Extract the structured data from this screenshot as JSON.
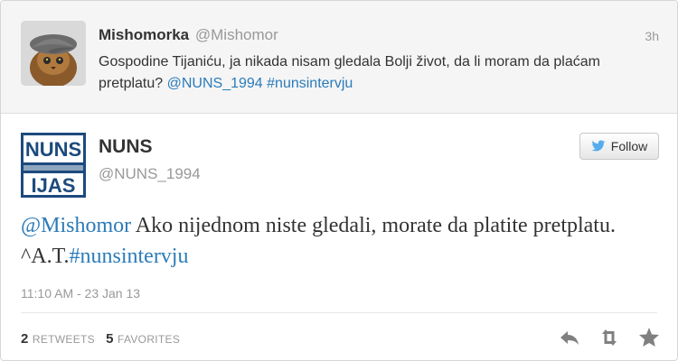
{
  "parent_tweet": {
    "fullname": "Mishomorka",
    "screen_name": "@Mishomor",
    "time": "3h",
    "text": "Gospodine Tijaniću, ja nikada nisam gledala Bolji život, da li moram da plaćam pretplatu?",
    "mention": "@NUNS_1994",
    "hashtag": "#nunsintervju",
    "avatar_icon": "cat-with-cap-avatar"
  },
  "tweet": {
    "fullname": "NUNS",
    "screen_name": "@NUNS_1994",
    "avatar_logo": {
      "top": "NUNS",
      "bottom": "IJAS"
    },
    "follow_label": "Follow",
    "mention": "@Mishomor",
    "text": " Ako nijednom niste gledali, morate da platite pretplatu. ^A.T.",
    "hashtag": "#nunsintervju",
    "timestamp": "11:10 AM - 23 Jan 13",
    "retweets_count": "2",
    "retweets_label": "RETWEETS",
    "favorites_count": "5",
    "favorites_label": "FAVORITES"
  },
  "colors": {
    "link": "#2b7bb9",
    "muted": "#999999",
    "nuns_blue": "#1c4a7d",
    "twitter_bird": "#55acee"
  },
  "icons": [
    "twitter-bird-icon",
    "reply-icon",
    "retweet-icon",
    "favorite-star-icon"
  ]
}
